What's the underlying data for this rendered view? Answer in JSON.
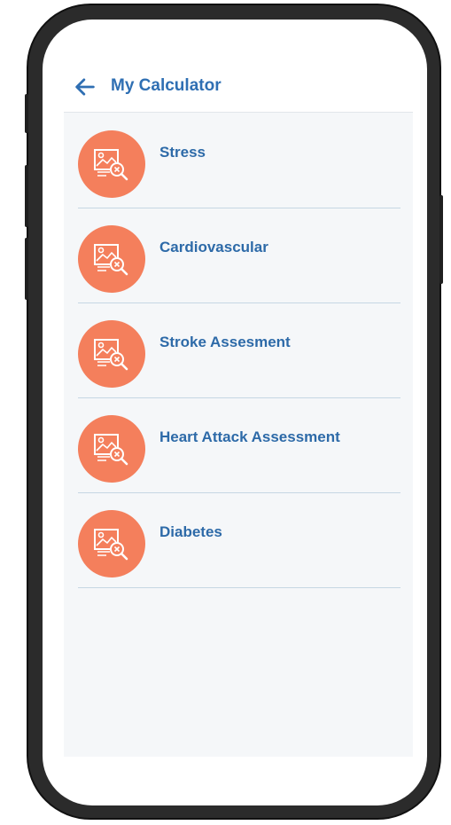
{
  "header": {
    "back_icon": "arrow-left-icon",
    "title": "My Calculator"
  },
  "colors": {
    "accent_blue": "#2f6fb3",
    "icon_bg_orange": "#f47f5c",
    "list_bg": "#f5f7f9",
    "divider": "#c6d7e3"
  },
  "calculators": [
    {
      "label": "Stress",
      "icon": "image-search-icon"
    },
    {
      "label": "Cardiovascular",
      "icon": "image-search-icon"
    },
    {
      "label": "Stroke Assesment",
      "icon": "image-search-icon"
    },
    {
      "label": "Heart Attack Assessment",
      "icon": "image-search-icon"
    },
    {
      "label": "Diabetes",
      "icon": "image-search-icon"
    }
  ]
}
